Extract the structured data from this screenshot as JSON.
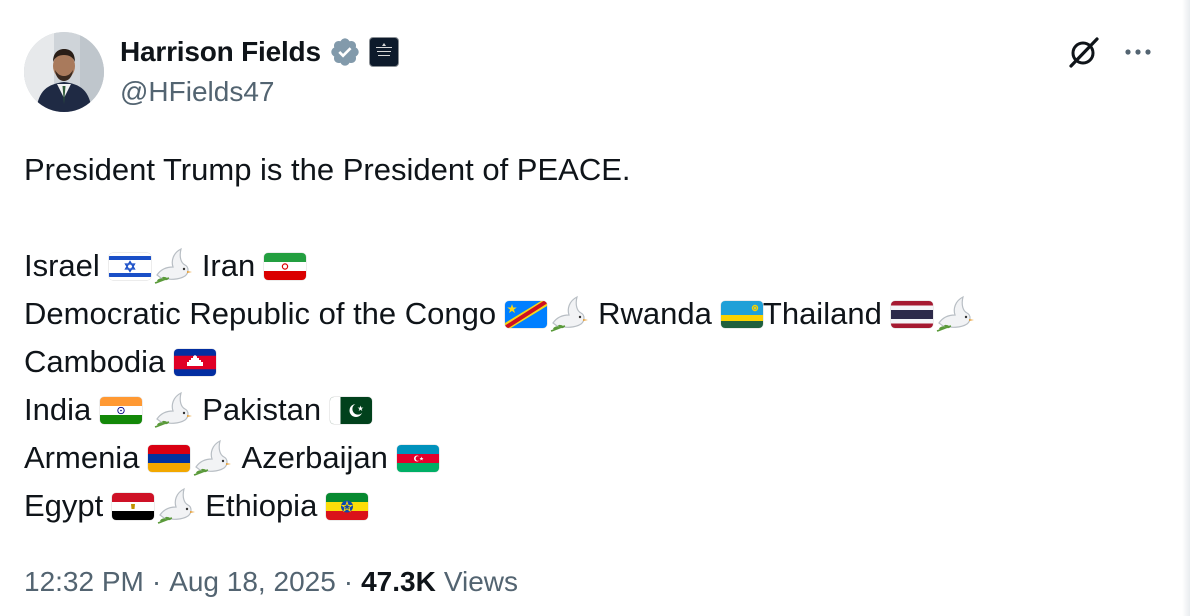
{
  "author": {
    "display_name": "Harrison Fields",
    "handle": "@HFields47",
    "verified_icon": "verified-badge-icon",
    "affiliation_icon": "white-house-affiliation-icon",
    "affiliation_text": "THE WHITE HOUSE"
  },
  "actions": {
    "grok_icon": "grok-icon",
    "more_icon": "more-options-icon"
  },
  "tweet": {
    "headline": "President Trump is the President of PEACE.",
    "lines": {
      "l1": {
        "a": "Israel",
        "b": "Iran"
      },
      "l2": {
        "a": "Democratic Republic of the Congo",
        "b": "Rwanda",
        "c": "Thailand"
      },
      "l3": {
        "a": "Cambodia"
      },
      "l4": {
        "a": "India",
        "b": "Pakistan"
      },
      "l5": {
        "a": "Armenia",
        "b": "Azerbaijan"
      },
      "l6": {
        "a": "Egypt",
        "b": "Ethiopia"
      }
    }
  },
  "meta": {
    "time": "12:32 PM",
    "separator": "·",
    "date": "Aug 18, 2025",
    "views_count": "47.3K",
    "views_label": "Views"
  },
  "colors": {
    "text_primary": "#0f1419",
    "text_secondary": "#536471",
    "verified_badge": "#829aab",
    "background": "#ffffff"
  }
}
